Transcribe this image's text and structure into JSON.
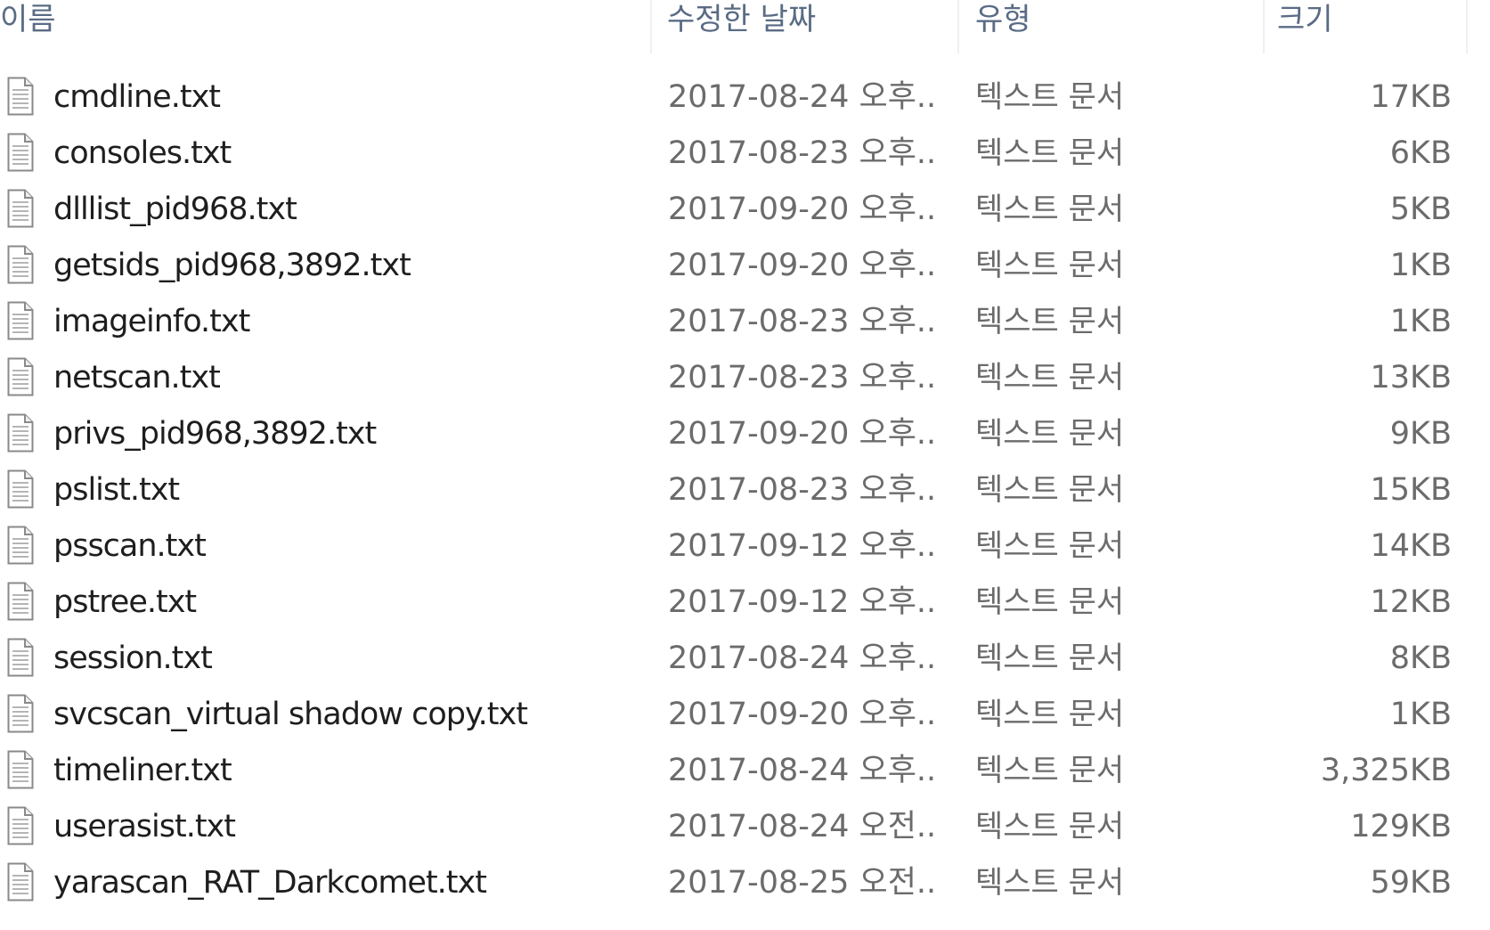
{
  "columns": {
    "name": "이름",
    "modified": "수정한 날짜",
    "type": "유형",
    "size": "크기"
  },
  "icon": "text-file-icon",
  "files": [
    {
      "name": "cmdline.txt",
      "modified": "2017-08-24 오후...",
      "type": "텍스트 문서",
      "size": "17KB"
    },
    {
      "name": "consoles.txt",
      "modified": "2017-08-23 오후...",
      "type": "텍스트 문서",
      "size": "6KB"
    },
    {
      "name": "dlllist_pid968.txt",
      "modified": "2017-09-20 오후...",
      "type": "텍스트 문서",
      "size": "5KB"
    },
    {
      "name": "getsids_pid968,3892.txt",
      "modified": "2017-09-20 오후...",
      "type": "텍스트 문서",
      "size": "1KB"
    },
    {
      "name": "imageinfo.txt",
      "modified": "2017-08-23 오후...",
      "type": "텍스트 문서",
      "size": "1KB"
    },
    {
      "name": "netscan.txt",
      "modified": "2017-08-23 오후...",
      "type": "텍스트 문서",
      "size": "13KB"
    },
    {
      "name": "privs_pid968,3892.txt",
      "modified": "2017-09-20 오후...",
      "type": "텍스트 문서",
      "size": "9KB"
    },
    {
      "name": "pslist.txt",
      "modified": "2017-08-23 오후...",
      "type": "텍스트 문서",
      "size": "15KB"
    },
    {
      "name": "psscan.txt",
      "modified": "2017-09-12 오후...",
      "type": "텍스트 문서",
      "size": "14KB"
    },
    {
      "name": "pstree.txt",
      "modified": "2017-09-12 오후...",
      "type": "텍스트 문서",
      "size": "12KB"
    },
    {
      "name": "session.txt",
      "modified": "2017-08-24 오후...",
      "type": "텍스트 문서",
      "size": "8KB"
    },
    {
      "name": "svcscan_virtual shadow copy.txt",
      "modified": "2017-09-20 오후...",
      "type": "텍스트 문서",
      "size": "1KB"
    },
    {
      "name": "timeliner.txt",
      "modified": "2017-08-24 오후...",
      "type": "텍스트 문서",
      "size": "3,325KB"
    },
    {
      "name": "userasist.txt",
      "modified": "2017-08-24 오전...",
      "type": "텍스트 문서",
      "size": "129KB"
    },
    {
      "name": "yarascan_RAT_Darkcomet.txt",
      "modified": "2017-08-25 오전...",
      "type": "텍스트 문서",
      "size": "59KB"
    }
  ]
}
